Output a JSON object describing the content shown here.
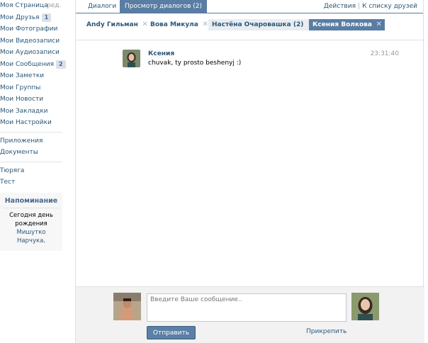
{
  "sidebar": {
    "items": [
      {
        "label": "Моя Страница",
        "extra": "ред."
      },
      {
        "label": "Мои Друзья",
        "count": "1"
      },
      {
        "label": "Мои Фотографии"
      },
      {
        "label": "Мои Видеозаписи"
      },
      {
        "label": "Мои Аудиозаписи"
      },
      {
        "label": "Мои Сообщения",
        "count": "2"
      },
      {
        "label": "Мои Заметки"
      },
      {
        "label": "Мои Группы"
      },
      {
        "label": "Мои Новости"
      },
      {
        "label": "Мои Закладки"
      },
      {
        "label": "Мои Настройки"
      }
    ],
    "items2": [
      {
        "label": "Приложения"
      },
      {
        "label": "Документы"
      }
    ],
    "items3": [
      {
        "label": "Тюряга"
      },
      {
        "label": "Тест"
      }
    ],
    "reminder": {
      "title": "Напоминание",
      "text_before": "Сегодня ",
      "text_day": "день рождения",
      "name": "Мишутко Нарчука",
      "text_after": "."
    }
  },
  "topbar": {
    "tabs": [
      "Диалоги",
      "Просмотр диалогов (2)"
    ],
    "actions": "Действия",
    "back": "К списку друзей"
  },
  "chips": [
    {
      "label": "Andy Гильман"
    },
    {
      "label": "Вова Микула"
    },
    {
      "label": "Настёна Очаровашка (2)"
    },
    {
      "label": "Ксения Волкова"
    }
  ],
  "message": {
    "sender": "Ксения",
    "text": "chuvak, ty prosto beshenyj :)",
    "time": "23:31:40"
  },
  "composer": {
    "placeholder": "Введите Ваше сообщение..",
    "send": "Отправить",
    "attach": "Прикрепить"
  },
  "colors": {
    "accent": "#597da3",
    "link": "#2b587a"
  }
}
